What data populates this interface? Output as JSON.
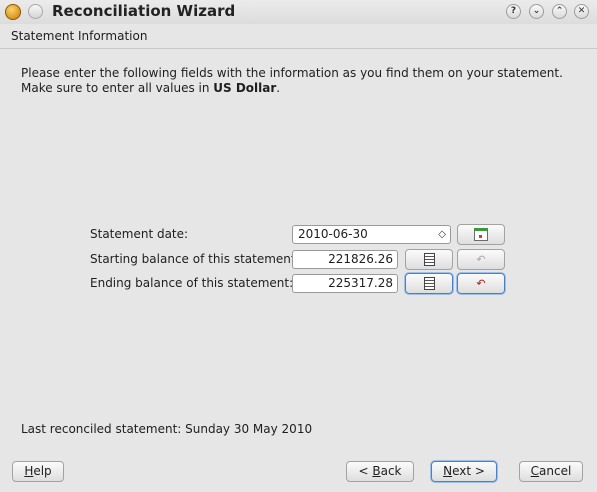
{
  "window": {
    "title": "Reconciliation Wizard",
    "controls": {
      "help": "?",
      "minimize": "⌄",
      "maximize": "⌃",
      "close": "✕"
    }
  },
  "page": {
    "heading": "Statement Information",
    "instructions_part1": "Please enter the following fields with the information as you find them on your statement. Make sure to enter all values in ",
    "currency": "US Dollar",
    "instructions_part2": "."
  },
  "form": {
    "date_label": "Statement date:",
    "date_value": "2010-06-30",
    "starting_label": "Starting balance of this statement:",
    "starting_value": "221826.26",
    "ending_label": "Ending balance of this statement:",
    "ending_value": "225317.28"
  },
  "status": {
    "last_reconciled": "Last reconciled statement: Sunday 30 May 2010"
  },
  "buttons": {
    "help_mnemonic": "H",
    "help_rest": "elp",
    "back_prefix": "< ",
    "back_mnemonic": "B",
    "back_rest": "ack",
    "next_mnemonic": "N",
    "next_rest": "ext >",
    "cancel_mnemonic": "C",
    "cancel_rest": "ancel"
  },
  "icons": {
    "app": "kmymoney-app-icon",
    "calendar": "calendar-icon",
    "calculator": "calculator-icon",
    "undo": "undo-icon"
  },
  "colors": {
    "background": "#e6e6e6",
    "focus": "#4a80c4",
    "undo_active": "#b01818"
  }
}
